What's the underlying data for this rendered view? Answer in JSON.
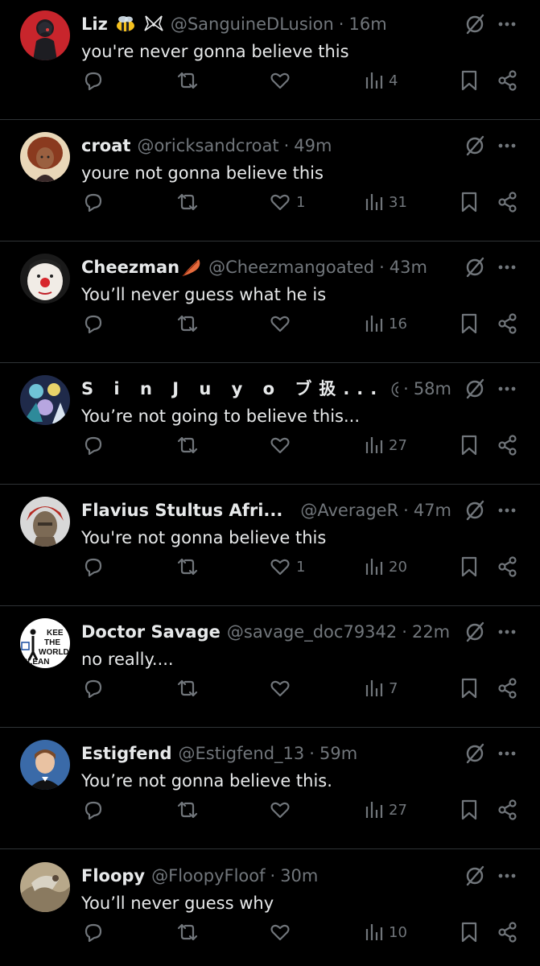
{
  "colors": {
    "background": "#000000",
    "text": "#e7e9ea",
    "secondary": "#71767b",
    "divider": "#2f3336"
  },
  "tweets": [
    {
      "name": "Liz",
      "name_emoji": [
        "bee-emoji",
        "wings-emoji"
      ],
      "handle": "@SanguineDLusion",
      "separator": "·",
      "time": "16m",
      "text": "you're never gonna believe this",
      "likes": "",
      "views": "4",
      "avatar": "avatar-red-anime-character"
    },
    {
      "name": "croat",
      "name_emoji": [],
      "handle": "@oricksandcroat",
      "separator": "·",
      "time": "49m",
      "text": "youre not gonna believe this",
      "likes": "1",
      "views": "31",
      "avatar": "avatar-curly-haired-cartoon"
    },
    {
      "name": "Cheezman",
      "name_emoji": [
        "feather-emoji"
      ],
      "handle": "@Cheezmangoated",
      "separator": "·",
      "time": "43m",
      "text": "You’ll never guess what he is",
      "likes": "",
      "views": "16",
      "avatar": "avatar-clown-face"
    },
    {
      "name": "S i n J u y o ブ扱...",
      "name_emoji": [],
      "handle": "@TealS...",
      "separator": "·",
      "time": "58m",
      "text": "You’re not going to believe this...",
      "likes": "",
      "views": "27",
      "avatar": "avatar-anime-group"
    },
    {
      "name": "Flavius Stultus Afri...",
      "name_emoji": [],
      "handle": "@AverageRo...",
      "separator": "·",
      "time": "47m",
      "text": "You're not gonna believe this",
      "likes": "1",
      "views": "20",
      "avatar": "avatar-roman-helmet"
    },
    {
      "name": "Doctor Savage",
      "name_emoji": [],
      "handle": "@savage_doc79342",
      "separator": "·",
      "time": "22m",
      "text": "no really....",
      "likes": "",
      "views": "7",
      "avatar": "avatar-keep-the-world-clean-sign",
      "avatar_text": [
        "KEE",
        "THE",
        "WORLD",
        "CLEAN"
      ]
    },
    {
      "name": "Estigfend",
      "name_emoji": [],
      "handle": "@Estigfend_13",
      "separator": "·",
      "time": "59m",
      "text": "You’re not gonna believe this.",
      "likes": "",
      "views": "27",
      "avatar": "avatar-person-in-suit"
    },
    {
      "name": "Floopy",
      "name_emoji": [],
      "handle": "@FloopyFloof",
      "separator": "·",
      "time": "30m",
      "text": "You’ll never guess why",
      "likes": "",
      "views": "10",
      "avatar": "avatar-painting"
    }
  ]
}
